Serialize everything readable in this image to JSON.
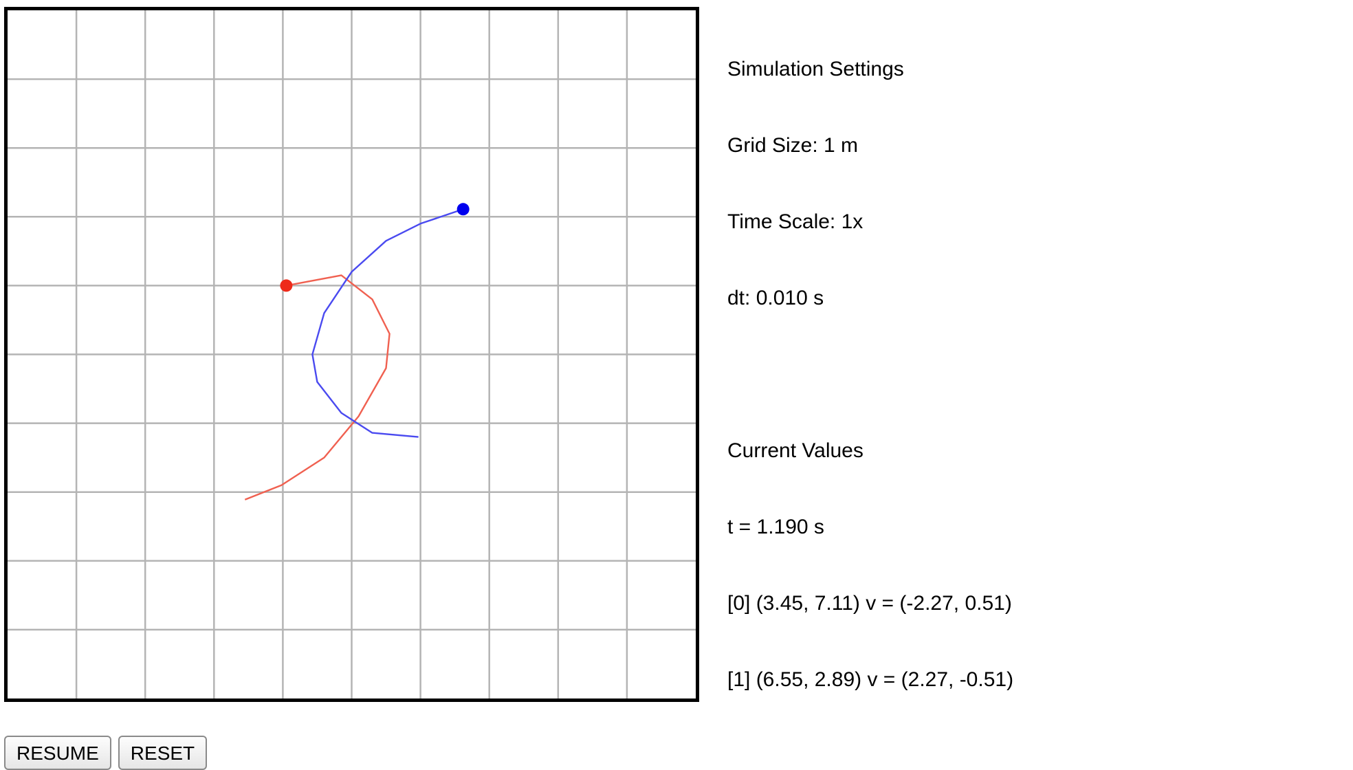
{
  "simulation": {
    "world_size_m": 10,
    "trail_color_0": "#4a4af0",
    "trail_color_1": "#f06050",
    "dot_color_0": "#0000ee",
    "dot_color_1": "#ee2a1a",
    "bodies": [
      {
        "index": 0,
        "trail": [
          [
            5.97,
            3.8
          ],
          [
            5.3,
            3.86
          ],
          [
            4.85,
            4.15
          ],
          [
            4.5,
            4.6
          ],
          [
            4.43,
            5.0
          ],
          [
            4.6,
            5.6
          ],
          [
            5.0,
            6.2
          ],
          [
            5.5,
            6.65
          ],
          [
            6.0,
            6.9
          ],
          [
            6.62,
            7.11
          ]
        ]
      },
      {
        "index": 1,
        "trail": [
          [
            3.45,
            2.89
          ],
          [
            3.98,
            3.1
          ],
          [
            4.6,
            3.5
          ],
          [
            5.1,
            4.1
          ],
          [
            5.5,
            4.8
          ],
          [
            5.55,
            5.3
          ],
          [
            5.3,
            5.8
          ],
          [
            4.85,
            6.15
          ],
          [
            4.05,
            6.0
          ]
        ]
      }
    ]
  },
  "settings": {
    "heading": "Simulation Settings",
    "grid_size": "Grid Size: 1 m",
    "time_scale": "Time Scale: 1x",
    "dt": "dt: 0.010 s"
  },
  "current": {
    "heading": "Current Values",
    "t": "t = 1.190 s",
    "body0": "[0] (3.45, 7.11) v = (-2.27, 0.51)",
    "body1": "[1] (6.55, 2.89) v = (2.27, -0.51)"
  },
  "controls": {
    "resume_label": "RESUME",
    "reset_label": "RESET"
  }
}
